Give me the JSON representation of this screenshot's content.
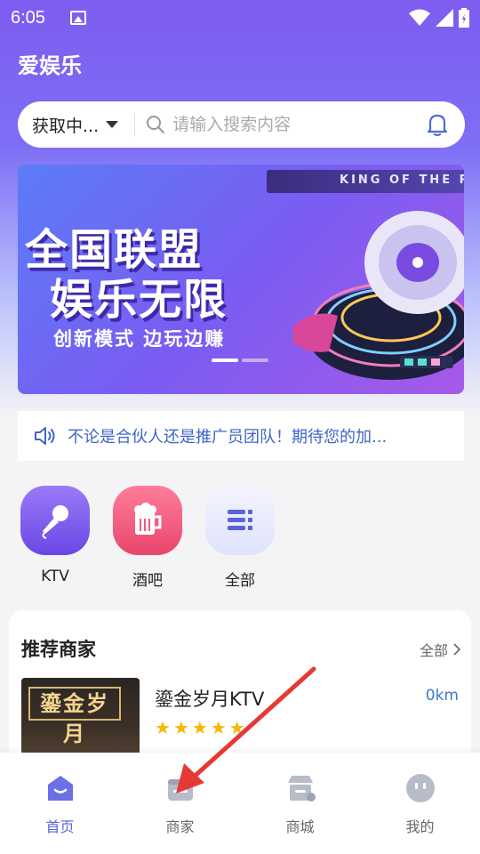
{
  "status_bar": {
    "time": "6:05"
  },
  "app": {
    "title": "爱娱乐"
  },
  "search": {
    "city": "获取中...",
    "placeholder": "请输入搜索内容"
  },
  "banner": {
    "top_text": "KING OF THE PE",
    "headline_1": "全国联盟",
    "headline_2": "娱乐无限",
    "subtitle": "创新模式  边玩边赚",
    "slides": 2,
    "active_slide": 1
  },
  "notice": {
    "text": "不论是合伙人还是推广员团队！期待您的加..."
  },
  "categories": [
    {
      "label": "KTV",
      "icon": "microphone-icon",
      "color": "#7a5cf0"
    },
    {
      "label": "酒吧",
      "icon": "beer-icon",
      "color": "#f2587c"
    },
    {
      "label": "全部",
      "icon": "list-icon",
      "color": "#5a63d8"
    }
  ],
  "recommend": {
    "title": "推荐商家",
    "all_label": "全部",
    "merchant": {
      "sign": "鎏金岁月",
      "name": "鎏金岁月KTV",
      "distance": "0km",
      "rating": 5
    }
  },
  "tabbar": [
    {
      "label": "首页",
      "icon": "home-icon",
      "active": true
    },
    {
      "label": "商家",
      "icon": "merchant-icon",
      "active": false
    },
    {
      "label": "商城",
      "icon": "mall-icon",
      "active": false
    },
    {
      "label": "我的",
      "icon": "profile-icon",
      "active": false
    }
  ],
  "colors": {
    "accent": "#5a63d8",
    "notice_text": "#3f66c8",
    "star": "#f5b800",
    "annotation_arrow": "#e53935"
  }
}
